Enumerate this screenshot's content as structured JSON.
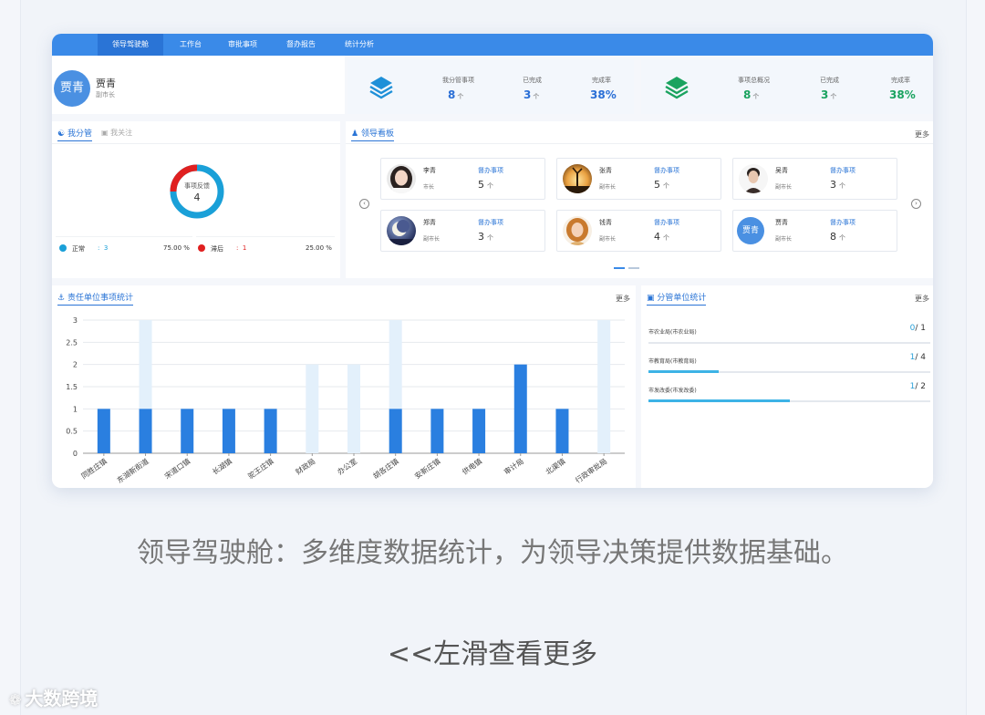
{
  "nav": {
    "items": [
      {
        "label": "领导驾驶舱"
      },
      {
        "label": "工作台"
      },
      {
        "label": "审批事项"
      },
      {
        "label": "督办报告"
      },
      {
        "label": "统计分析"
      }
    ]
  },
  "profile": {
    "avatar_text": "贾青",
    "name": "贾青",
    "role": "副市长"
  },
  "stats_left": {
    "icon": "layers-icon",
    "color": "#1e90d8",
    "items": [
      {
        "label": "我分管事项",
        "value": "8",
        "unit": "个"
      },
      {
        "label": "已完成",
        "value": "3",
        "unit": "个"
      },
      {
        "label": "完成率",
        "value": "38%"
      }
    ]
  },
  "stats_right": {
    "icon": "layers-icon",
    "color": "#1aa35f",
    "items": [
      {
        "label": "事项总概况",
        "value": "8",
        "unit": "个"
      },
      {
        "label": "已完成",
        "value": "3",
        "unit": "个"
      },
      {
        "label": "完成率",
        "value": "38%"
      }
    ]
  },
  "my_division": {
    "tab_active": "我分管",
    "tab_inactive": "我关注",
    "donut_label": "事项反馈",
    "donut_total": "4",
    "donut_segments": [
      {
        "name": "正常",
        "value": 3,
        "percent": "75.00 %",
        "color": "#1aa0d8"
      },
      {
        "name": "滞后",
        "value": 1,
        "percent": "25.00 %",
        "color": "#e02020"
      }
    ]
  },
  "leader_board": {
    "title": "领导看板",
    "more": "更多",
    "task_label": "督办事项",
    "unit": "个",
    "leaders": [
      {
        "name": "李青",
        "role": "市长",
        "count": "5",
        "photo": "woman-portrait"
      },
      {
        "name": "张青",
        "role": "副市长",
        "count": "5",
        "photo": "sunset-silhouette"
      },
      {
        "name": "吴青",
        "role": "副市长",
        "count": "3",
        "photo": "man-portrait"
      },
      {
        "name": "郑青",
        "role": "副市长",
        "count": "3",
        "photo": "moon-night"
      },
      {
        "name": "钱青",
        "role": "副市长",
        "count": "4",
        "photo": "woman-portrait-2"
      },
      {
        "name": "贾青",
        "role": "副市长",
        "count": "8",
        "photo": "text-avatar",
        "avatar_text": "贾青"
      }
    ]
  },
  "responsibility_chart": {
    "title": "责任单位事项统计",
    "more": "更多"
  },
  "chart_data": {
    "type": "bar",
    "categories": [
      "同胜庄镇",
      "东湖新街道",
      "宋道口镇",
      "长湖镇",
      "驼王庄镇",
      "财政局",
      "办公室",
      "胡各庄镇",
      "安新庄镇",
      "供电镇",
      "审计局",
      "北渠镇",
      "行政审批局"
    ],
    "series": [
      {
        "values": [
          1,
          1,
          1,
          1,
          1,
          0,
          0,
          1,
          1,
          1,
          2,
          1,
          0
        ],
        "color": "#2a7fe0"
      },
      {
        "values": [
          0,
          3,
          0,
          0,
          0,
          2,
          2,
          3,
          0,
          0,
          0,
          0,
          3
        ],
        "color": "#e3f0fb"
      }
    ],
    "ylim": [
      0,
      3
    ],
    "yticks": [
      "0",
      "0.5",
      "1",
      "1.5",
      "2",
      "2.5",
      "3"
    ],
    "grid": true
  },
  "unit_stats": {
    "title": "分管单位统计",
    "more": "更多",
    "rows": [
      {
        "label": "市农业局(市农业局)",
        "done": "0",
        "total": "/ 1",
        "ratio": 0
      },
      {
        "label": "市教育局(市教育局)",
        "done": "1",
        "total": "/ 4",
        "ratio": 0.25
      },
      {
        "label": "市发改委(市发改委)",
        "done": "1",
        "total": "/ 2",
        "ratio": 0.5
      }
    ]
  },
  "caption": "领导驾驶舱：多维度数据统计，为领导决策提供数据基础。",
  "swipe_hint": "<<左滑查看更多",
  "watermark": "大数跨境"
}
